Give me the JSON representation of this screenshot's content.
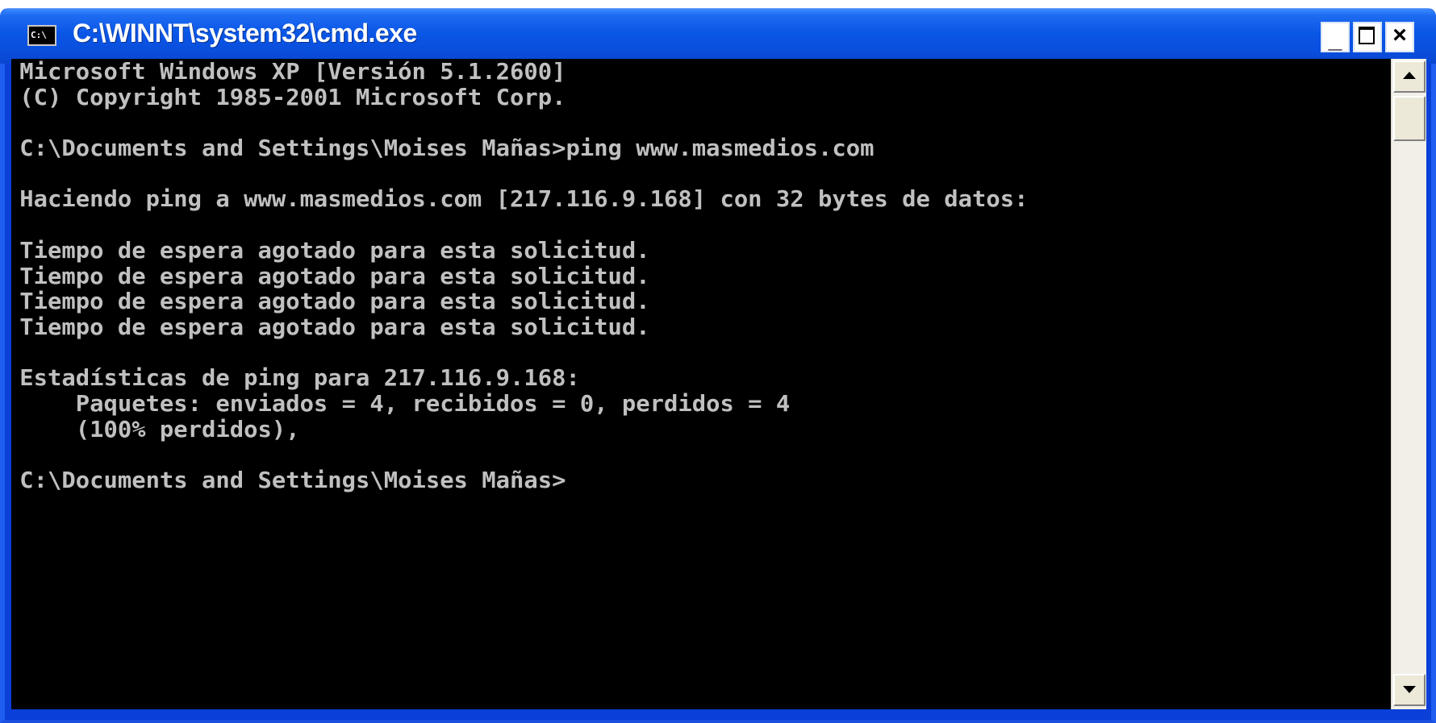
{
  "window": {
    "title": "C:\\WINNT\\system32\\cmd.exe",
    "icon": "console-icon",
    "icon_text": "C:\\",
    "buttons": {
      "minimize": "_",
      "maximize": "maximize-icon",
      "close": "×"
    }
  },
  "console": {
    "lines": [
      "Microsoft Windows XP [Versión 5.1.2600]",
      "(C) Copyright 1985-2001 Microsoft Corp.",
      "",
      "C:\\Documents and Settings\\Moises Mañas>ping www.masmedios.com",
      "",
      "Haciendo ping a www.masmedios.com [217.116.9.168] con 32 bytes de datos:",
      "",
      "Tiempo de espera agotado para esta solicitud.",
      "Tiempo de espera agotado para esta solicitud.",
      "Tiempo de espera agotado para esta solicitud.",
      "Tiempo de espera agotado para esta solicitud.",
      "",
      "Estadísticas de ping para 217.116.9.168:",
      "    Paquetes: enviados = 4, recibidos = 0, perdidos = 4",
      "    (100% perdidos),",
      "",
      "C:\\Documents and Settings\\Moises Mañas>"
    ],
    "background": "#000000",
    "foreground": "#c0c0c0"
  },
  "scrollbar": {
    "up_icon": "arrow-up-icon",
    "down_icon": "arrow-down-icon"
  }
}
